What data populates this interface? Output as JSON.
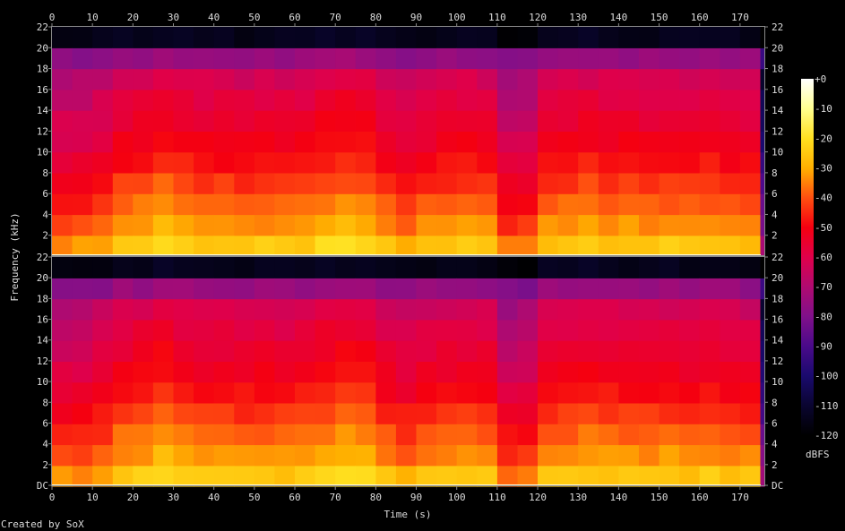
{
  "chart_data": {
    "type": "heatmap",
    "title": "",
    "xlabel": "Time (s)",
    "ylabel": "Frequency (kHz)",
    "xlim": [
      0,
      176
    ],
    "ylim": [
      0,
      22
    ],
    "x_ticks": [
      "0",
      "10",
      "20",
      "30",
      "40",
      "50",
      "60",
      "70",
      "80",
      "90",
      "100",
      "110",
      "120",
      "130",
      "140",
      "150",
      "160",
      "170"
    ],
    "y_ticks_top_channel": [
      "2",
      "4",
      "6",
      "8",
      "10",
      "12",
      "14",
      "16",
      "18",
      "20",
      "22"
    ],
    "y_ticks_bottom_channel": [
      "DC",
      "2",
      "4",
      "6",
      "8",
      "10",
      "12",
      "14",
      "16",
      "18",
      "20",
      "22"
    ],
    "channels": 2,
    "time_bin_s": 5,
    "freq_bin_khz": 2,
    "freq_profile_db": [
      -27,
      -35,
      -40,
      -45,
      -50,
      -54,
      -57,
      -60,
      -64,
      -76,
      -115
    ],
    "time_offset_db": [
      -6,
      -6,
      -3,
      2,
      3,
      6,
      3,
      2,
      2,
      1,
      2,
      1,
      2,
      5,
      6,
      5,
      0,
      -3,
      0,
      1,
      2,
      1,
      -9,
      -8,
      1,
      2,
      3,
      2,
      2,
      1,
      2,
      1,
      2,
      1,
      0,
      -45
    ],
    "dc_line_db": -3,
    "colorbar": {
      "label": "dBFS",
      "range": [
        -120,
        0
      ],
      "ticks": [
        "+0",
        "-10",
        "-20",
        "-30",
        "-40",
        "-50",
        "-60",
        "-70",
        "-80",
        "-90",
        "-100",
        "-110",
        "-120"
      ]
    }
  },
  "footer": "Created by SoX"
}
